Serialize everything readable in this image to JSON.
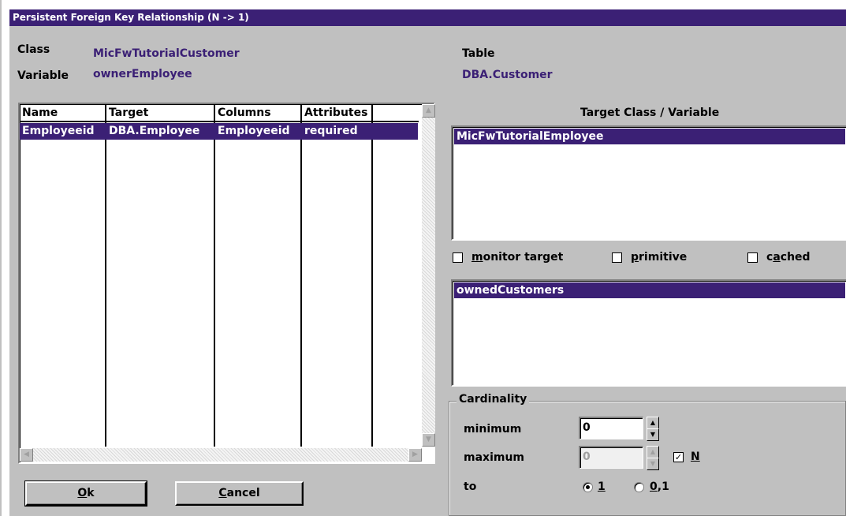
{
  "window": {
    "title": "Persistent Foreign Key Relationship (N -> 1)"
  },
  "info": {
    "class_label": "Class",
    "class_value": "MicFwTutorialCustomer",
    "variable_label": "Variable",
    "variable_value": "ownerEmployee",
    "table_label": "Table",
    "table_value": "DBA.Customer"
  },
  "grid": {
    "columns": [
      "Name",
      "Target",
      "Columns",
      "Attributes"
    ],
    "rows": [
      {
        "name": "Employeeid",
        "target": "DBA.Employee",
        "columns": "Employeeid",
        "attributes": "required"
      }
    ]
  },
  "target": {
    "header": "Target Class / Variable",
    "class_selected": "MicFwTutorialEmployee",
    "variable_selected": "ownedCustomers"
  },
  "options": {
    "monitor_target": {
      "label_mnemonic": "m",
      "label_rest": "onitor target",
      "checked": false
    },
    "primitive": {
      "label_mnemonic": "p",
      "label_rest": "rimitive",
      "checked": false
    },
    "cached": {
      "label_pre": "c",
      "label_mnemonic": "a",
      "label_rest": "ched",
      "checked": false
    }
  },
  "cardinality": {
    "caption": "Cardinality",
    "minimum_label": "minimum",
    "minimum_value": "0",
    "maximum_label": "maximum",
    "maximum_value": "0",
    "n_label": "N",
    "n_checked": true,
    "to_label": "to",
    "to_option1": "1",
    "to_option2_mnemonic": "0",
    "to_option2_rest": ",1",
    "to_selected": "1"
  },
  "buttons": {
    "ok_mnemonic": "O",
    "ok_rest": "k",
    "cancel_mnemonic": "C",
    "cancel_rest": "ancel"
  },
  "colors": {
    "accent": "#3b2075",
    "dialog": "#c0c0c0"
  }
}
